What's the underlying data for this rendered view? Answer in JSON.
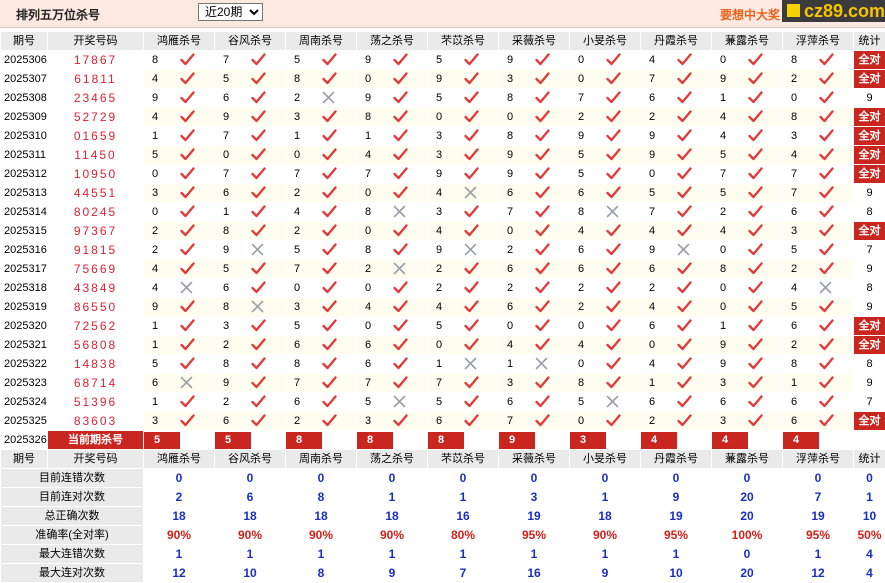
{
  "header": {
    "title": "排列五万位杀号",
    "period_selected": "近20期",
    "promo_text": "要想中大奖",
    "logo_text": "cz89.com"
  },
  "table": {
    "columns": [
      "期号",
      "开奖号码",
      "鸿雁杀号",
      "谷风杀号",
      "周南杀号",
      "荡之杀号",
      "芣苡杀号",
      "采薇杀号",
      "小旻杀号",
      "丹霞杀号",
      "蒹露杀号",
      "浮萍杀号",
      "统计"
    ],
    "rows": [
      {
        "period": "2025306",
        "numbers": "17867",
        "kills": [
          8,
          7,
          5,
          9,
          5,
          9,
          0,
          4,
          0,
          8
        ],
        "marks": [
          1,
          1,
          1,
          1,
          1,
          1,
          1,
          1,
          1,
          1
        ],
        "total": "全对"
      },
      {
        "period": "2025307",
        "numbers": "61811",
        "kills": [
          4,
          5,
          8,
          0,
          9,
          3,
          0,
          7,
          9,
          2
        ],
        "marks": [
          1,
          1,
          1,
          1,
          1,
          1,
          1,
          1,
          1,
          1
        ],
        "total": "全对"
      },
      {
        "period": "2025308",
        "numbers": "23465",
        "kills": [
          9,
          6,
          2,
          9,
          5,
          8,
          7,
          6,
          1,
          0
        ],
        "marks": [
          1,
          1,
          0,
          1,
          1,
          1,
          1,
          1,
          1,
          1
        ],
        "total": "9"
      },
      {
        "period": "2025309",
        "numbers": "52729",
        "kills": [
          4,
          9,
          3,
          8,
          0,
          0,
          2,
          2,
          4,
          8
        ],
        "marks": [
          1,
          1,
          1,
          1,
          1,
          1,
          1,
          1,
          1,
          1
        ],
        "total": "全对"
      },
      {
        "period": "2025310",
        "numbers": "01659",
        "kills": [
          1,
          7,
          1,
          1,
          3,
          8,
          9,
          9,
          4,
          3
        ],
        "marks": [
          1,
          1,
          1,
          1,
          1,
          1,
          1,
          1,
          1,
          1
        ],
        "total": "全对"
      },
      {
        "period": "2025311",
        "numbers": "11450",
        "kills": [
          5,
          0,
          0,
          4,
          3,
          9,
          5,
          9,
          5,
          4
        ],
        "marks": [
          1,
          1,
          1,
          1,
          1,
          1,
          1,
          1,
          1,
          1
        ],
        "total": "全对"
      },
      {
        "period": "2025312",
        "numbers": "10950",
        "kills": [
          0,
          7,
          7,
          7,
          9,
          9,
          5,
          0,
          7,
          7
        ],
        "marks": [
          1,
          1,
          1,
          1,
          1,
          1,
          1,
          1,
          1,
          1
        ],
        "total": "全对"
      },
      {
        "period": "2025313",
        "numbers": "44551",
        "kills": [
          3,
          6,
          2,
          0,
          4,
          6,
          6,
          5,
          5,
          7
        ],
        "marks": [
          1,
          1,
          1,
          1,
          0,
          1,
          1,
          1,
          1,
          1
        ],
        "total": "9"
      },
      {
        "period": "2025314",
        "numbers": "80245",
        "kills": [
          0,
          1,
          4,
          8,
          3,
          7,
          8,
          7,
          2,
          6
        ],
        "marks": [
          1,
          1,
          1,
          0,
          1,
          1,
          0,
          1,
          1,
          1
        ],
        "total": "8"
      },
      {
        "period": "2025315",
        "numbers": "97367",
        "kills": [
          2,
          8,
          2,
          0,
          4,
          0,
          4,
          4,
          4,
          3
        ],
        "marks": [
          1,
          1,
          1,
          1,
          1,
          1,
          1,
          1,
          1,
          1
        ],
        "total": "全对"
      },
      {
        "period": "2025316",
        "numbers": "91815",
        "kills": [
          2,
          9,
          5,
          8,
          9,
          2,
          6,
          9,
          0,
          5
        ],
        "marks": [
          1,
          0,
          1,
          1,
          0,
          1,
          1,
          0,
          1,
          1
        ],
        "total": "7"
      },
      {
        "period": "2025317",
        "numbers": "75669",
        "kills": [
          4,
          5,
          7,
          2,
          2,
          6,
          6,
          6,
          8,
          2
        ],
        "marks": [
          1,
          1,
          1,
          0,
          1,
          1,
          1,
          1,
          1,
          1
        ],
        "total": "9"
      },
      {
        "period": "2025318",
        "numbers": "43849",
        "kills": [
          4,
          6,
          0,
          0,
          2,
          2,
          2,
          2,
          0,
          4
        ],
        "marks": [
          0,
          1,
          1,
          1,
          1,
          1,
          1,
          1,
          1,
          0
        ],
        "total": "8"
      },
      {
        "period": "2025319",
        "numbers": "86550",
        "kills": [
          9,
          8,
          3,
          4,
          4,
          6,
          2,
          4,
          0,
          5
        ],
        "marks": [
          1,
          0,
          1,
          1,
          1,
          1,
          1,
          1,
          1,
          1
        ],
        "total": "9"
      },
      {
        "period": "2025320",
        "numbers": "72562",
        "kills": [
          1,
          3,
          5,
          0,
          5,
          0,
          0,
          6,
          1,
          6
        ],
        "marks": [
          1,
          1,
          1,
          1,
          1,
          1,
          1,
          1,
          1,
          1
        ],
        "total": "全对"
      },
      {
        "period": "2025321",
        "numbers": "56808",
        "kills": [
          1,
          2,
          6,
          6,
          0,
          4,
          4,
          0,
          9,
          2
        ],
        "marks": [
          1,
          1,
          1,
          1,
          1,
          1,
          1,
          1,
          1,
          1
        ],
        "total": "全对"
      },
      {
        "period": "2025322",
        "numbers": "14838",
        "kills": [
          5,
          8,
          8,
          6,
          1,
          1,
          0,
          4,
          9,
          8
        ],
        "marks": [
          1,
          1,
          1,
          1,
          0,
          0,
          1,
          1,
          1,
          1
        ],
        "total": "8"
      },
      {
        "period": "2025323",
        "numbers": "68714",
        "kills": [
          6,
          9,
          7,
          7,
          7,
          3,
          8,
          1,
          3,
          1
        ],
        "marks": [
          0,
          1,
          1,
          1,
          1,
          1,
          1,
          1,
          1,
          1
        ],
        "total": "9"
      },
      {
        "period": "2025324",
        "numbers": "51396",
        "kills": [
          1,
          2,
          6,
          5,
          5,
          6,
          5,
          6,
          6,
          6
        ],
        "marks": [
          1,
          1,
          1,
          0,
          1,
          1,
          0,
          1,
          1,
          1
        ],
        "total": "7"
      },
      {
        "period": "2025325",
        "numbers": "83603",
        "kills": [
          3,
          6,
          2,
          3,
          6,
          7,
          0,
          2,
          3,
          6
        ],
        "marks": [
          1,
          1,
          1,
          1,
          1,
          1,
          1,
          1,
          1,
          1
        ],
        "total": "全对"
      }
    ],
    "current": {
      "period": "2025326",
      "label": "当前期杀号",
      "kills": [
        "5",
        "5",
        "8",
        "8",
        "8",
        "9",
        "3",
        "4",
        "4",
        "4"
      ]
    }
  },
  "stats": {
    "columns": [
      "期号",
      "开奖号码",
      "鸿雁杀号",
      "谷风杀号",
      "周南杀号",
      "荡之杀号",
      "芣苡杀号",
      "采薇杀号",
      "小旻杀号",
      "丹霞杀号",
      "蒹露杀号",
      "浮萍杀号",
      "统计"
    ],
    "rows": [
      {
        "label": "目前连错次数",
        "color": "blue",
        "values": [
          "0",
          "0",
          "0",
          "0",
          "0",
          "0",
          "0",
          "0",
          "0",
          "0",
          "0"
        ]
      },
      {
        "label": "目前连对次数",
        "color": "blue",
        "values": [
          "2",
          "6",
          "8",
          "1",
          "1",
          "3",
          "1",
          "9",
          "20",
          "7",
          "1"
        ]
      },
      {
        "label": "总正确次数",
        "color": "blue",
        "values": [
          "18",
          "18",
          "18",
          "18",
          "16",
          "19",
          "18",
          "19",
          "20",
          "19",
          "10"
        ]
      },
      {
        "label": "准确率(全对率)",
        "color": "red",
        "values": [
          "90%",
          "90%",
          "90%",
          "90%",
          "80%",
          "95%",
          "90%",
          "95%",
          "100%",
          "95%",
          "50%"
        ]
      },
      {
        "label": "最大连错次数",
        "color": "blue",
        "values": [
          "1",
          "1",
          "1",
          "1",
          "1",
          "1",
          "1",
          "1",
          "0",
          "1",
          "4"
        ]
      },
      {
        "label": "最大连对次数",
        "color": "blue",
        "values": [
          "12",
          "10",
          "8",
          "9",
          "7",
          "16",
          "9",
          "10",
          "20",
          "12",
          "4"
        ]
      }
    ]
  },
  "colors": {
    "check": "#e03a3a",
    "cross": "#9aa0a8",
    "accent_red": "#c8261f",
    "blue_text": "#1a2fbf"
  },
  "icons": {
    "correct": "check-icon",
    "wrong": "cross-icon"
  }
}
